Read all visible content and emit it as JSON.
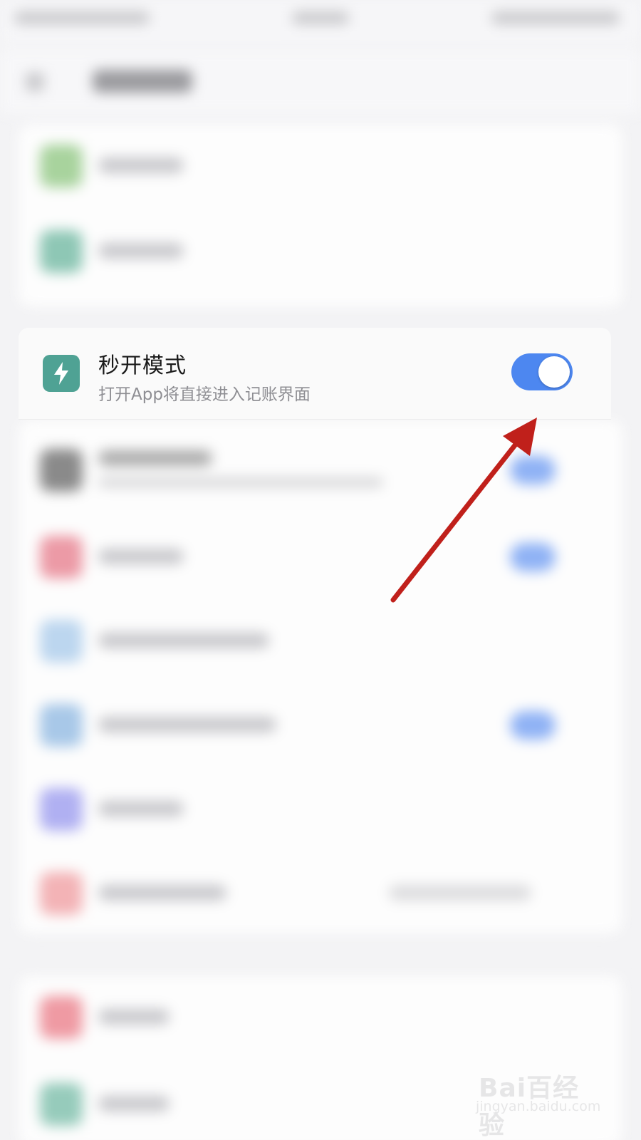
{
  "setting": {
    "title": "秒开模式",
    "subtitle": "打开App将直接进入记账界面",
    "icon": "lightning-icon",
    "toggle_on": true,
    "icon_color": "#4fa294",
    "toggle_color": "#4d87f0"
  },
  "annotation": {
    "arrow_color": "#c0201b"
  },
  "watermark": {
    "logo": "Bai百经验",
    "url": "jingyan.baidu.com"
  }
}
